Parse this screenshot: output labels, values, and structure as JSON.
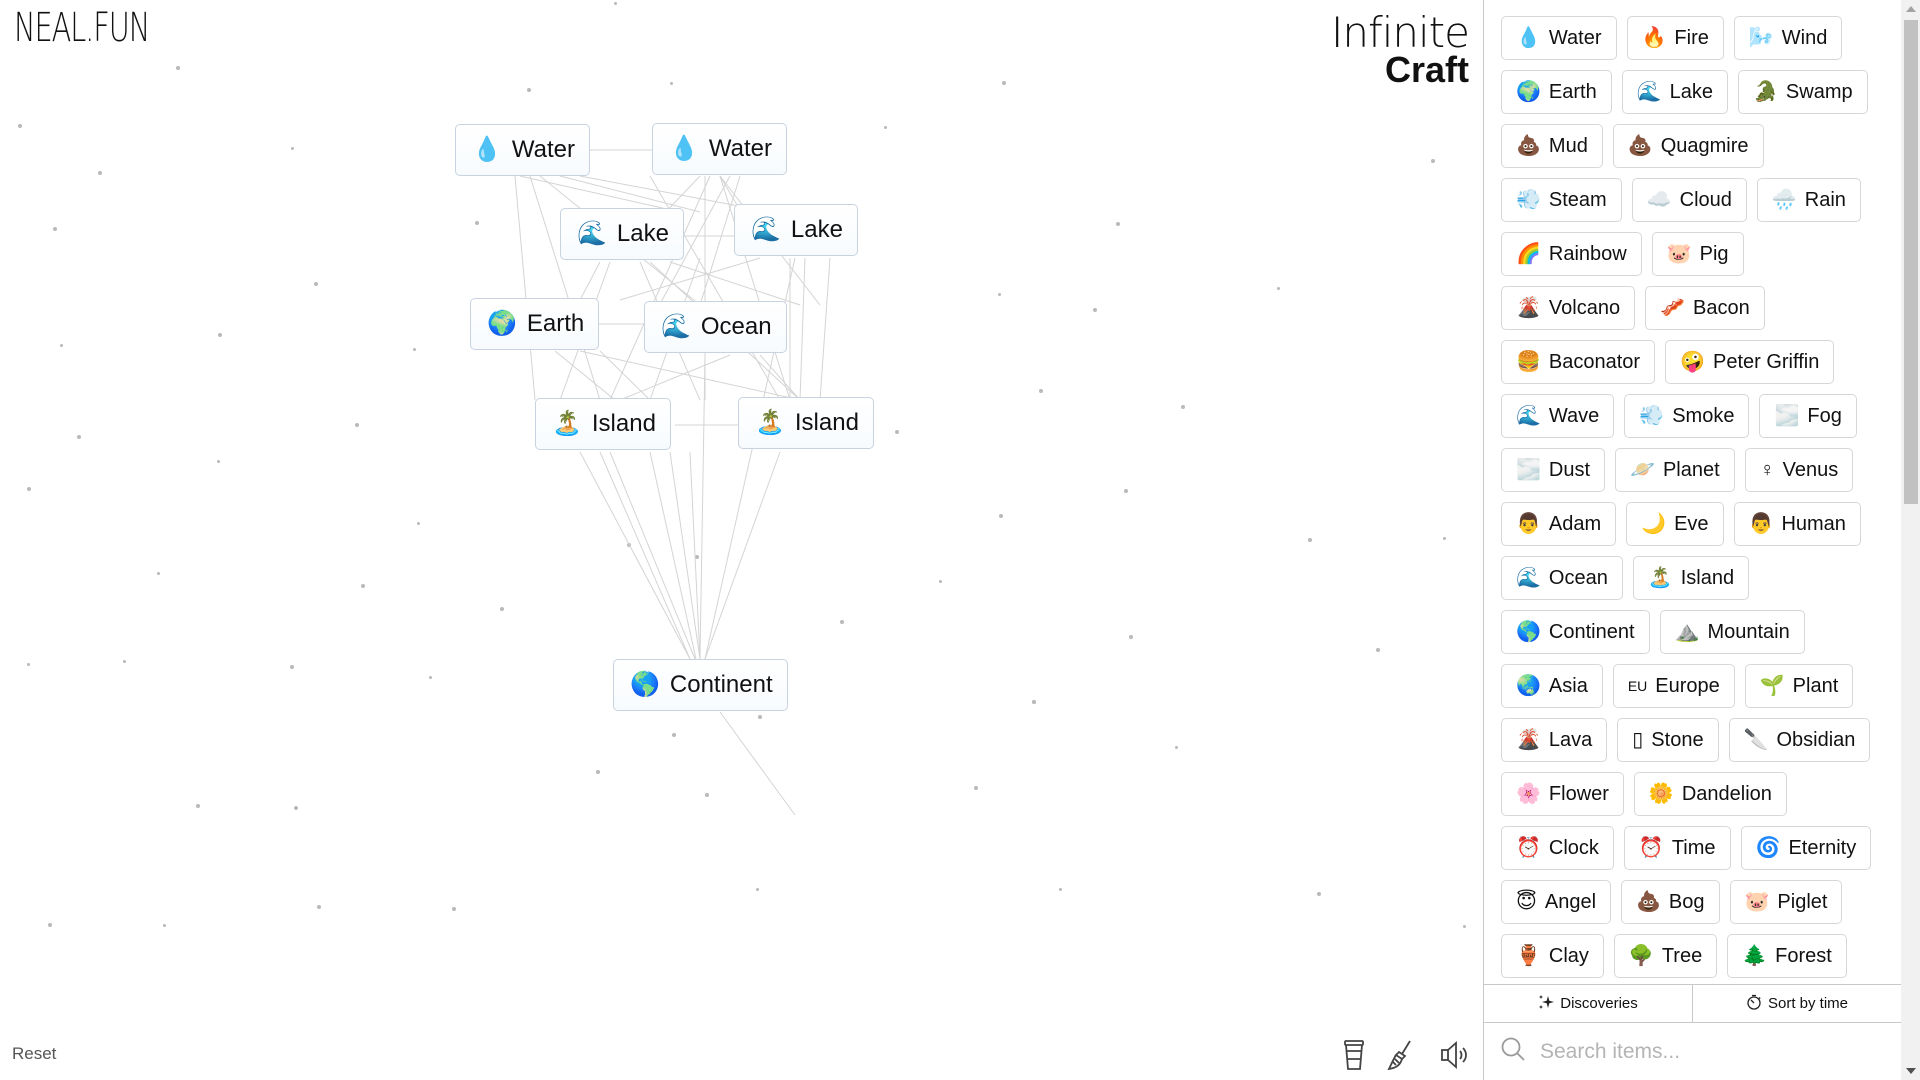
{
  "brand": {
    "site_logo": "NEAL.FUN",
    "game_title_line1": "Infinite",
    "game_title_line2": "Craft"
  },
  "canvas": {
    "instances": [
      {
        "label": "Water",
        "emoji": "💧",
        "icon": "water-drop-icon"
      },
      {
        "label": "Water",
        "emoji": "💧",
        "icon": "water-drop-icon"
      },
      {
        "label": "Lake",
        "emoji": "🌊",
        "icon": "wave-icon"
      },
      {
        "label": "Lake",
        "emoji": "🌊",
        "icon": "wave-icon"
      },
      {
        "label": "Earth",
        "emoji": "🌍",
        "icon": "globe-africa-icon"
      },
      {
        "label": "Ocean",
        "emoji": "🌊",
        "icon": "wave-icon"
      },
      {
        "label": "Island",
        "emoji": "🏝️",
        "icon": "palm-island-icon"
      },
      {
        "label": "Island",
        "emoji": "🏝️",
        "icon": "palm-island-icon"
      },
      {
        "label": "Continent",
        "emoji": "🌎",
        "icon": "globe-americas-icon"
      }
    ],
    "reset_label": "Reset",
    "tools": [
      {
        "name": "donate-coffee-icon"
      },
      {
        "name": "broom-clear-icon"
      },
      {
        "name": "sound-speaker-icon"
      }
    ]
  },
  "sidebar": {
    "items": [
      {
        "label": "Water",
        "emoji": "💧"
      },
      {
        "label": "Fire",
        "emoji": "🔥"
      },
      {
        "label": "Wind",
        "emoji": "🌬️"
      },
      {
        "label": "Earth",
        "emoji": "🌍"
      },
      {
        "label": "Lake",
        "emoji": "🌊"
      },
      {
        "label": "Swamp",
        "emoji": "🐊"
      },
      {
        "label": "Mud",
        "emoji": "💩"
      },
      {
        "label": "Quagmire",
        "emoji": "💩"
      },
      {
        "label": "Steam",
        "emoji": "💨"
      },
      {
        "label": "Cloud",
        "emoji": "☁️"
      },
      {
        "label": "Rain",
        "emoji": "🌧️"
      },
      {
        "label": "Rainbow",
        "emoji": "🌈"
      },
      {
        "label": "Pig",
        "emoji": "🐷"
      },
      {
        "label": "Volcano",
        "emoji": "🌋"
      },
      {
        "label": "Bacon",
        "emoji": "🥓"
      },
      {
        "label": "Baconator",
        "emoji": "🍔"
      },
      {
        "label": "Peter Griffin",
        "emoji": "🤪"
      },
      {
        "label": "Wave",
        "emoji": "🌊"
      },
      {
        "label": "Smoke",
        "emoji": "💨"
      },
      {
        "label": "Fog",
        "emoji": "🌫️"
      },
      {
        "label": "Dust",
        "emoji": "🌫️"
      },
      {
        "label": "Planet",
        "emoji": "🪐"
      },
      {
        "label": "Venus",
        "emoji": "♀"
      },
      {
        "label": "Adam",
        "emoji": "👨"
      },
      {
        "label": "Eve",
        "emoji": "🌙"
      },
      {
        "label": "Human",
        "emoji": "👨"
      },
      {
        "label": "Ocean",
        "emoji": "🌊"
      },
      {
        "label": "Island",
        "emoji": "🏝️"
      },
      {
        "label": "Continent",
        "emoji": "🌎"
      },
      {
        "label": "Mountain",
        "emoji": "⛰️"
      },
      {
        "label": "Asia",
        "emoji": "🌏"
      },
      {
        "label": "Europe",
        "emoji": "EU"
      },
      {
        "label": "Plant",
        "emoji": "🌱"
      },
      {
        "label": "Lava",
        "emoji": "🌋"
      },
      {
        "label": "Stone",
        "emoji": "▯"
      },
      {
        "label": "Obsidian",
        "emoji": "🔪"
      },
      {
        "label": "Flower",
        "emoji": "🌸"
      },
      {
        "label": "Dandelion",
        "emoji": "🌼"
      },
      {
        "label": "Clock",
        "emoji": "⏰"
      },
      {
        "label": "Time",
        "emoji": "⏰"
      },
      {
        "label": "Eternity",
        "emoji": "🌀"
      },
      {
        "label": "Angel",
        "emoji": "😇"
      },
      {
        "label": "Bog",
        "emoji": "💩"
      },
      {
        "label": "Piglet",
        "emoji": "🐷"
      },
      {
        "label": "Clay",
        "emoji": "🏺"
      },
      {
        "label": "Tree",
        "emoji": "🌳"
      },
      {
        "label": "Forest",
        "emoji": "🌲"
      }
    ],
    "discoveries_label": "Discoveries",
    "sort_label": "Sort by time",
    "search_placeholder": "Search items..."
  }
}
